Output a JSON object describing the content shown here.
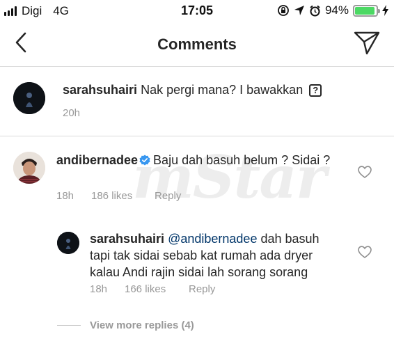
{
  "status_bar": {
    "carrier": "Digi",
    "network": "4G",
    "time": "17:05",
    "battery_percent": "94%",
    "battery_level": 0.94,
    "icons": [
      "signal-bars-icon",
      "orientation-lock-icon",
      "location-arrow-icon",
      "alarm-clock-icon",
      "battery-icon",
      "charging-bolt-icon"
    ]
  },
  "nav": {
    "title": "Comments",
    "back_icon": "chevron-left-icon",
    "send_icon": "direct-send-icon"
  },
  "caption": {
    "username": "sarahsuhairi",
    "text": "Nak pergi mana? I bawakkan",
    "emoji_glyph": "?",
    "time": "20h"
  },
  "comments": [
    {
      "username": "andibernadee",
      "verified": true,
      "text": "Baju dah basuh belum ? Sidai ?",
      "time": "18h",
      "likes": "186 likes",
      "reply_label": "Reply"
    }
  ],
  "reply": {
    "username": "sarahsuhairi",
    "mention": "@andibernadee",
    "text_line1_rest": "dah basuh",
    "text_line2": "tapi tak sidai sebab kat rumah ada dryer",
    "text_line3": "kalau Andi rajin sidai lah sorang sorang",
    "time": "18h",
    "likes": "166 likes",
    "reply_label": "Reply"
  },
  "view_more": "View more replies (4)",
  "watermark": "mStar",
  "colors": {
    "text": "#262626",
    "meta": "#999999",
    "mention": "#003569",
    "verified": "#3897f0",
    "battery": "#4cd964",
    "divider": "#dbdbdb"
  }
}
